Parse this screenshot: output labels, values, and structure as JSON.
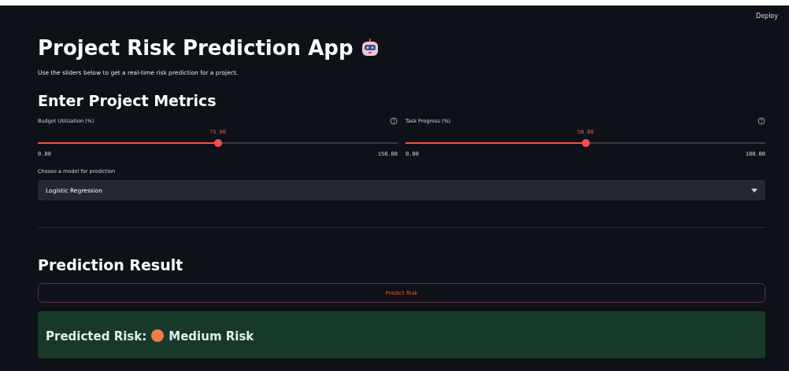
{
  "header": {
    "deploy": "Deploy"
  },
  "title": "Project Risk Prediction App",
  "subtitle": "Use the sliders below to get a real-time risk prediction for a project.",
  "metrics_heading": "Enter Project Metrics",
  "sliders": [
    {
      "label": "Budget Utilization (%)",
      "reading": "75.00",
      "min": "0.00",
      "max": "150.00",
      "level": 0.5
    },
    {
      "label": "Task Progress (%)",
      "reading": "50.00",
      "min": "0.00",
      "max": "100.00",
      "level": 0.5
    }
  ],
  "model_select": {
    "label": "Choose a model for prediction",
    "value": "Logistic Regression"
  },
  "result_heading": "Prediction Result",
  "predict_button": "Predict Risk",
  "result": {
    "label": "Predicted Risk:",
    "value": "Medium Risk",
    "color": "#f07b4f"
  }
}
